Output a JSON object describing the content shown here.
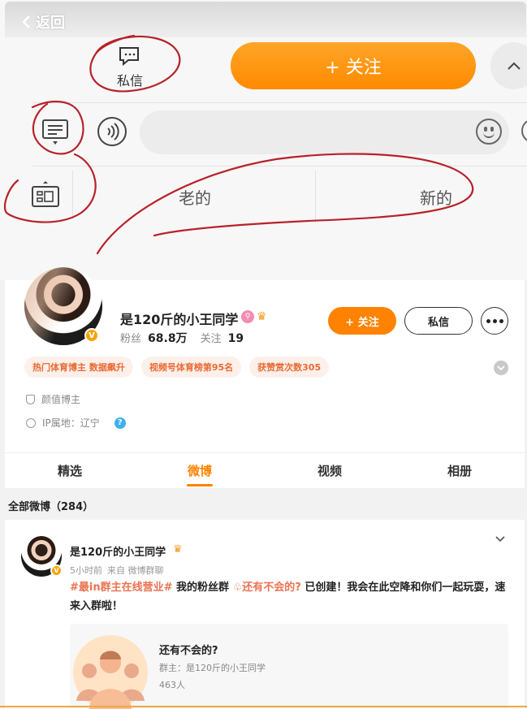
{
  "annotated_screenshot": {
    "back_label": "返回",
    "message_label": "私信",
    "follow_label": "+ 关注",
    "option_old": "老的",
    "option_new": "新的"
  },
  "profile": {
    "name": "是120斤的小王同学",
    "verified_badge": "V",
    "fans_label": "粉丝",
    "fans_value": "68.8万",
    "following_label": "关注",
    "following_value": "19",
    "follow_button": "+ 关注",
    "message_button": "私信",
    "tags": [
      "热门体育博主 数据飙升",
      "视频号体育榜第95名",
      "获赞赏次数305"
    ],
    "info": {
      "category": "颜值博主",
      "ip_location": "IP属地：辽宁",
      "help": "?"
    }
  },
  "tabs": [
    {
      "label": "精选",
      "active": false
    },
    {
      "label": "微博",
      "active": true
    },
    {
      "label": "视频",
      "active": false
    },
    {
      "label": "相册",
      "active": false
    }
  ],
  "feed": {
    "section_label": "全部微博（284）",
    "post": {
      "author": "是120斤的小王同学",
      "time": "5小时前",
      "source": "来自 微博群聊",
      "hashtag": "#最in群主在线营业#",
      "text_a": "我的粉丝群",
      "group_link": "还有不会的?",
      "text_b": "已创建！我会在此空降和你们一起玩耍，速来入群啦！",
      "group_card": {
        "title": "还有不会的?",
        "owner": "群主：是120斤的小王同学",
        "count": "463人"
      }
    }
  },
  "colors": {
    "accent": "#ff8200",
    "tag_text": "#e96a33",
    "annotation": "#b8222a"
  }
}
